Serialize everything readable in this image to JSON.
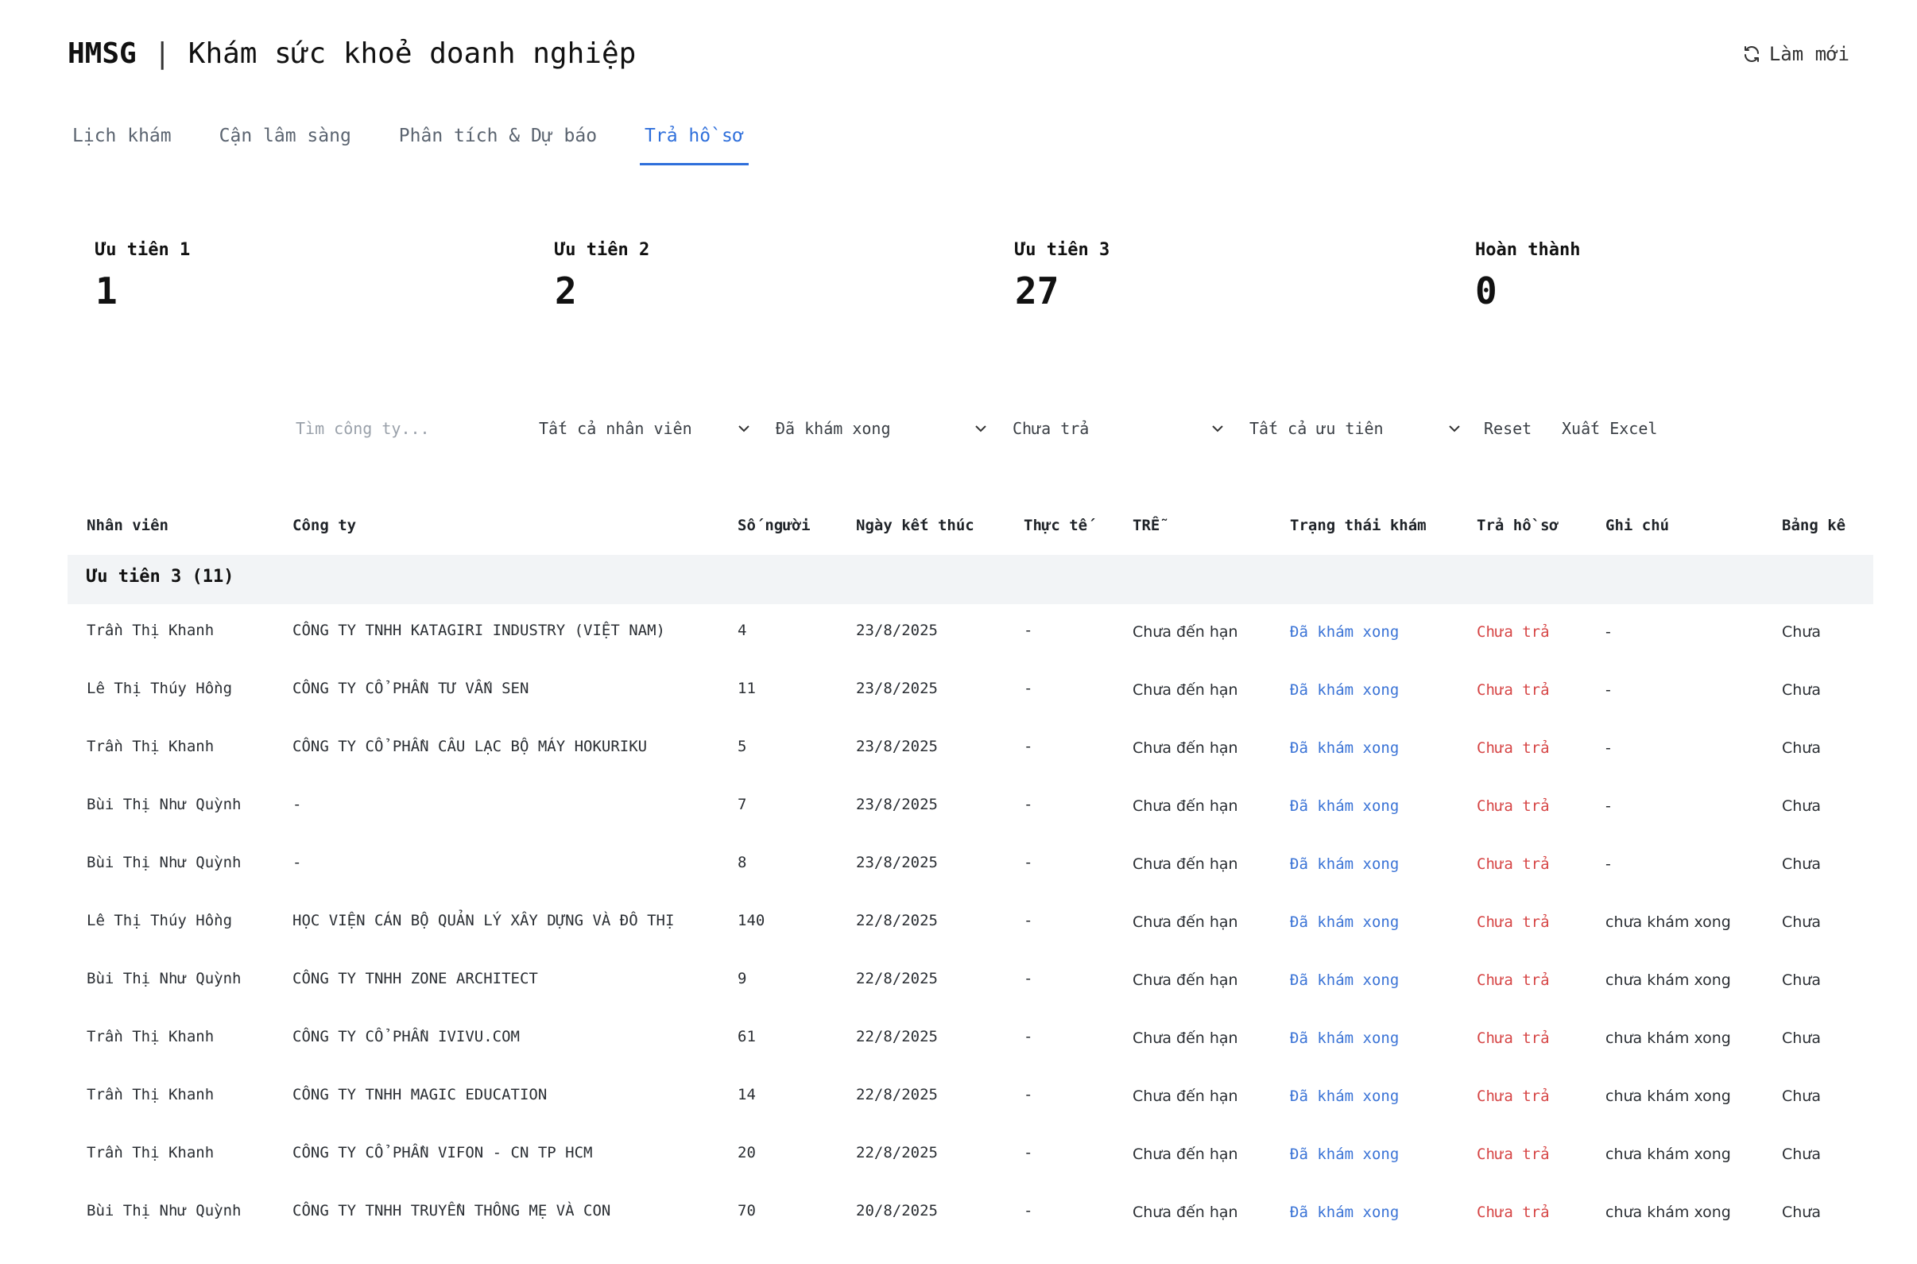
{
  "header": {
    "brand_code": "HMSG",
    "separator": "|",
    "brand_title": "Khám sức khoẻ doanh nghiệp",
    "refresh_label": "Làm mới"
  },
  "tabs": [
    {
      "label": "Lịch khám"
    },
    {
      "label": "Cận lâm sàng"
    },
    {
      "label": "Phân tích & Dự báo"
    },
    {
      "label": "Trả hồ sơ",
      "active": true
    }
  ],
  "stats": [
    {
      "label": "Ưu tiên 1",
      "value": "1"
    },
    {
      "label": "Ưu tiên 2",
      "value": "2"
    },
    {
      "label": "Ưu tiên 3",
      "value": "27"
    },
    {
      "label": "Hoàn thành",
      "value": "0"
    }
  ],
  "filters": {
    "search_placeholder": "Tìm công ty...",
    "employee": "Tất cả nhân viên",
    "exam_status": "Đã khám xong",
    "return_status": "Chưa trả",
    "priority": "Tất cả ưu tiên",
    "reset_label": "Reset",
    "export_label": "Xuất Excel"
  },
  "table": {
    "headers": [
      "Nhân viên",
      "Công ty",
      "Số người",
      "Ngày kết thúc",
      "Thực tế",
      "TRỄ",
      "Trạng thái khám",
      "Trả hồ sơ",
      "Ghi chú",
      "Bảng kê"
    ],
    "group_label": "Ưu tiên 3 (11)",
    "rows": [
      [
        "Trần Thị Khanh",
        "CÔNG TY TNHH KATAGIRI INDUSTRY (VIỆT NAM)",
        "4",
        "23/8/2025",
        "-",
        "Chưa đến hạn",
        "Đã khám xong",
        "Chưa trả",
        "-",
        "Chưa"
      ],
      [
        "Lê Thị Thúy Hồng",
        "CÔNG TY CỔ PHẦN TƯ VẤN SEN",
        "11",
        "23/8/2025",
        "-",
        "Chưa đến hạn",
        "Đã khám xong",
        "Chưa trả",
        "-",
        "Chưa"
      ],
      [
        "Trần Thị Khanh",
        "CÔNG TY CỔ PHẦN CÂU LẠC BỘ MÁY HOKURIKU",
        "5",
        "23/8/2025",
        "-",
        "Chưa đến hạn",
        "Đã khám xong",
        "Chưa trả",
        "-",
        "Chưa"
      ],
      [
        "Bùi Thị Như Quỳnh",
        "-",
        "7",
        "23/8/2025",
        "-",
        "Chưa đến hạn",
        "Đã khám xong",
        "Chưa trả",
        "-",
        "Chưa"
      ],
      [
        "Bùi Thị Như Quỳnh",
        "-",
        "8",
        "23/8/2025",
        "-",
        "Chưa đến hạn",
        "Đã khám xong",
        "Chưa trả",
        "-",
        "Chưa"
      ],
      [
        "Lê Thị Thúy Hồng",
        "HỌC VIỆN CÁN BỘ QUẢN LÝ XÂY DỰNG VÀ ĐÔ THỊ",
        "140",
        "22/8/2025",
        "-",
        "Chưa đến hạn",
        "Đã khám xong",
        "Chưa trả",
        "chưa khám xong",
        "Chưa"
      ],
      [
        "Bùi Thị Như Quỳnh",
        "CÔNG TY TNHH ZONE ARCHITECT",
        "9",
        "22/8/2025",
        "-",
        "Chưa đến hạn",
        "Đã khám xong",
        "Chưa trả",
        "chưa khám xong",
        "Chưa"
      ],
      [
        "Trần Thị Khanh",
        "CÔNG TY CỔ PHẦN IVIVU.COM",
        "61",
        "22/8/2025",
        "-",
        "Chưa đến hạn",
        "Đã khám xong",
        "Chưa trả",
        "chưa khám xong",
        "Chưa"
      ],
      [
        "Trần Thị Khanh",
        "CÔNG TY TNHH MAGIC EDUCATION",
        "14",
        "22/8/2025",
        "-",
        "Chưa đến hạn",
        "Đã khám xong",
        "Chưa trả",
        "chưa khám xong",
        "Chưa"
      ],
      [
        "Trần Thị Khanh",
        "CÔNG TY CỔ PHẦN VIFON - CN TP HCM",
        "20",
        "22/8/2025",
        "-",
        "Chưa đến hạn",
        "Đã khám xong",
        "Chưa trả",
        "chưa khám xong",
        "Chưa"
      ],
      [
        "Bùi Thị Như Quỳnh",
        "CÔNG TY TNHH TRUYỀN THÔNG MẸ VÀ CON",
        "70",
        "20/8/2025",
        "-",
        "Chưa đến hạn",
        "Đã khám xong",
        "Chưa trả",
        "chưa khám xong",
        "Chưa"
      ]
    ]
  },
  "colors": {
    "accent": "#2f6fdb",
    "exam_done": "#3a73d6",
    "not_returned": "#d64545",
    "group_bg": "#f2f4f6"
  },
  "icons": {
    "refresh": "refresh-icon",
    "dropdown": "chevron-down-icon"
  }
}
